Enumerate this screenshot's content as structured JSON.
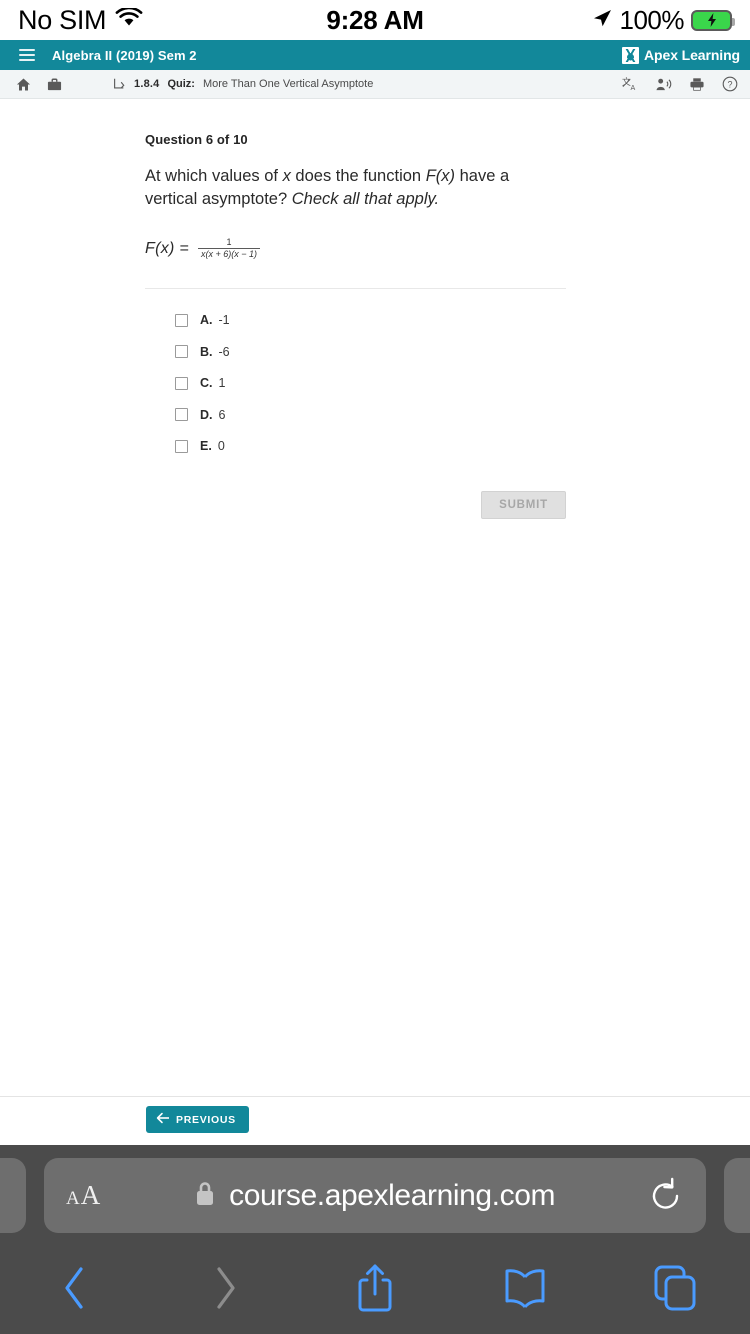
{
  "status_bar": {
    "carrier": "No SIM",
    "wifi_icon": "wifi-icon",
    "time": "9:28 AM",
    "location_icon": "location-arrow-icon",
    "battery_percent": "100%",
    "battery_icon": "battery-charging-icon"
  },
  "apex_header": {
    "menu_icon": "hamburger-menu-icon",
    "course_title": "Algebra II (2019) Sem 2",
    "logo_text": "Apex Learning",
    "logo_mark": "apex-logo-mark",
    "background_color": "#12889a"
  },
  "sub_toolbar": {
    "home_icon": "home-icon",
    "briefcase_icon": "briefcase-icon",
    "up_level_icon": "up-level-arrow-icon",
    "lesson_number": "1.8.4",
    "activity_type": "Quiz:",
    "activity_name": "More Than One Vertical Asymptote",
    "translate_icon": "translate-icon",
    "read_aloud_icon": "read-aloud-icon",
    "print_icon": "print-icon",
    "help_icon": "help-circle-icon"
  },
  "question": {
    "number_label": "Question 6 of 10",
    "prompt_part1": "At which values of ",
    "prompt_var1": "x",
    "prompt_part2": " does the function ",
    "prompt_var2": "F(x)",
    "prompt_part3": " have a vertical asymptote? ",
    "prompt_instruction": "Check all that apply.",
    "formula_lhs": "F(x)  =",
    "formula_numerator": "1",
    "formula_denominator": "x(x + 6)(x − 1)",
    "options": [
      {
        "letter": "A.",
        "value": "-1",
        "checked": false
      },
      {
        "letter": "B.",
        "value": "-6",
        "checked": false
      },
      {
        "letter": "C.",
        "value": "1",
        "checked": false
      },
      {
        "letter": "D.",
        "value": "6",
        "checked": false
      },
      {
        "letter": "E.",
        "value": "0",
        "checked": false
      }
    ],
    "submit_label": "SUBMIT",
    "submit_enabled": false
  },
  "apex_footer": {
    "previous_label": "PREVIOUS",
    "previous_icon": "arrow-left-icon"
  },
  "safari": {
    "text_size_small": "A",
    "text_size_big": "A",
    "lock_icon": "lock-icon",
    "url": "course.apexlearning.com",
    "reload_icon": "reload-icon",
    "back_icon": "chevron-left-icon",
    "forward_icon": "chevron-right-icon",
    "share_icon": "share-icon",
    "bookmarks_icon": "book-icon",
    "tabs_icon": "tabs-icon",
    "accent_color": "#4a9bff",
    "chrome_color": "#4b4b4b"
  }
}
